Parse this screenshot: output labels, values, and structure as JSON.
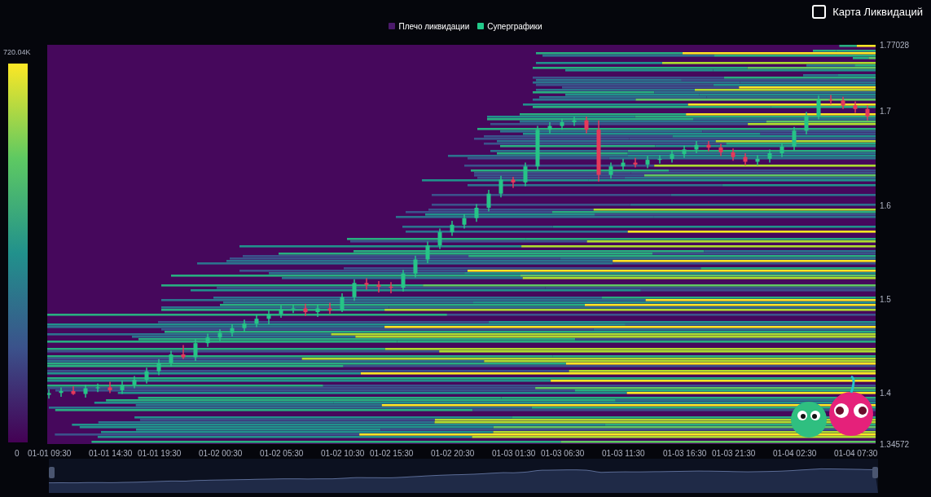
{
  "toggle": {
    "label": "Карта Ликвидаций",
    "checked": false
  },
  "legend": [
    {
      "label": "Плечо ликвидации",
      "color": "#4b1a6b"
    },
    {
      "label": "Суперграфики",
      "color": "#22c98a"
    }
  ],
  "color_scale": {
    "max_label": "720.04K",
    "min_label": "0"
  },
  "chart_data": {
    "type": "candlestick",
    "ylim": [
      1.34572,
      1.77028
    ],
    "yticks": [
      {
        "value": 1.77028,
        "label": "1.77028"
      },
      {
        "value": 1.7,
        "label": "1.7"
      },
      {
        "value": 1.6,
        "label": "1.6"
      },
      {
        "value": 1.5,
        "label": "1.5"
      },
      {
        "value": 1.4,
        "label": "1.4"
      },
      {
        "value": 1.34572,
        "label": "1.34572"
      }
    ],
    "categories": [
      "01-01 09:30",
      null,
      null,
      null,
      null,
      "01-01 14:30",
      null,
      null,
      null,
      "01-01 19:30",
      null,
      null,
      null,
      null,
      "01-02 00:30",
      null,
      null,
      null,
      null,
      "01-02 05:30",
      null,
      null,
      null,
      null,
      "01-02 10:30",
      null,
      null,
      null,
      "01-02 15:30",
      null,
      null,
      null,
      null,
      "01-02 20:30",
      null,
      null,
      null,
      null,
      "01-03 01:30",
      null,
      null,
      null,
      "01-03 06:30",
      null,
      null,
      null,
      null,
      "01-03 11:30",
      null,
      null,
      null,
      null,
      "01-03 16:30",
      null,
      null,
      null,
      "01-03 21:30",
      null,
      null,
      null,
      null,
      "01-04 02:30",
      null,
      null,
      null,
      null,
      "01-04 07:30",
      null
    ],
    "ohlc": [
      [
        1.398,
        1.404,
        1.394,
        1.4
      ],
      [
        1.4,
        1.406,
        1.396,
        1.402
      ],
      [
        1.402,
        1.407,
        1.398,
        1.399
      ],
      [
        1.399,
        1.409,
        1.395,
        1.405
      ],
      [
        1.405,
        1.41,
        1.401,
        1.406
      ],
      [
        1.406,
        1.412,
        1.4,
        1.403
      ],
      [
        1.403,
        1.413,
        1.399,
        1.409
      ],
      [
        1.409,
        1.418,
        1.405,
        1.414
      ],
      [
        1.414,
        1.427,
        1.41,
        1.423
      ],
      [
        1.423,
        1.436,
        1.419,
        1.432
      ],
      [
        1.432,
        1.445,
        1.428,
        1.441
      ],
      [
        1.441,
        1.451,
        1.436,
        1.438
      ],
      [
        1.438,
        1.457,
        1.434,
        1.453
      ],
      [
        1.453,
        1.463,
        1.449,
        1.459
      ],
      [
        1.459,
        1.468,
        1.455,
        1.464
      ],
      [
        1.464,
        1.473,
        1.46,
        1.469
      ],
      [
        1.469,
        1.478,
        1.465,
        1.474
      ],
      [
        1.474,
        1.483,
        1.47,
        1.479
      ],
      [
        1.479,
        1.488,
        1.473,
        1.484
      ],
      [
        1.484,
        1.493,
        1.48,
        1.489
      ],
      [
        1.489,
        1.494,
        1.485,
        1.49
      ],
      [
        1.49,
        1.495,
        1.482,
        1.486
      ],
      [
        1.486,
        1.494,
        1.481,
        1.49
      ],
      [
        1.49,
        1.496,
        1.484,
        1.488
      ],
      [
        1.488,
        1.506,
        1.486,
        1.502
      ],
      [
        1.502,
        1.521,
        1.498,
        1.517
      ],
      [
        1.517,
        1.522,
        1.51,
        1.515
      ],
      [
        1.515,
        1.519,
        1.507,
        1.513
      ],
      [
        1.513,
        1.518,
        1.506,
        1.512
      ],
      [
        1.512,
        1.531,
        1.508,
        1.527
      ],
      [
        1.527,
        1.546,
        1.523,
        1.542
      ],
      [
        1.542,
        1.561,
        1.538,
        1.557
      ],
      [
        1.557,
        1.575,
        1.553,
        1.571
      ],
      [
        1.571,
        1.583,
        1.567,
        1.579
      ],
      [
        1.579,
        1.59,
        1.575,
        1.586
      ],
      [
        1.586,
        1.601,
        1.582,
        1.597
      ],
      [
        1.597,
        1.616,
        1.593,
        1.612
      ],
      [
        1.612,
        1.631,
        1.608,
        1.627
      ],
      [
        1.627,
        1.63,
        1.618,
        1.624
      ],
      [
        1.624,
        1.645,
        1.62,
        1.641
      ],
      [
        1.641,
        1.684,
        1.637,
        1.68
      ],
      [
        1.68,
        1.688,
        1.676,
        1.684
      ],
      [
        1.684,
        1.692,
        1.68,
        1.688
      ],
      [
        1.688,
        1.694,
        1.684,
        1.69
      ],
      [
        1.69,
        1.694,
        1.676,
        1.68
      ],
      [
        1.68,
        1.69,
        1.625,
        1.632
      ],
      [
        1.632,
        1.645,
        1.628,
        1.641
      ],
      [
        1.641,
        1.649,
        1.637,
        1.645
      ],
      [
        1.645,
        1.65,
        1.64,
        1.643
      ],
      [
        1.643,
        1.652,
        1.639,
        1.648
      ],
      [
        1.648,
        1.653,
        1.644,
        1.649
      ],
      [
        1.649,
        1.658,
        1.645,
        1.654
      ],
      [
        1.654,
        1.663,
        1.65,
        1.659
      ],
      [
        1.659,
        1.668,
        1.655,
        1.664
      ],
      [
        1.664,
        1.668,
        1.657,
        1.661
      ],
      [
        1.661,
        1.665,
        1.652,
        1.656
      ],
      [
        1.656,
        1.66,
        1.647,
        1.651
      ],
      [
        1.651,
        1.655,
        1.642,
        1.646
      ],
      [
        1.646,
        1.653,
        1.642,
        1.649
      ],
      [
        1.649,
        1.659,
        1.645,
        1.655
      ],
      [
        1.655,
        1.666,
        1.651,
        1.662
      ],
      [
        1.662,
        1.683,
        1.658,
        1.679
      ],
      [
        1.679,
        1.699,
        1.675,
        1.695
      ],
      [
        1.695,
        1.716,
        1.691,
        1.712
      ],
      [
        1.712,
        1.717,
        1.707,
        1.711
      ],
      [
        1.711,
        1.715,
        1.702,
        1.706
      ],
      [
        1.706,
        1.71,
        1.698,
        1.702
      ],
      [
        1.702,
        1.706,
        1.69,
        1.694
      ]
    ]
  }
}
